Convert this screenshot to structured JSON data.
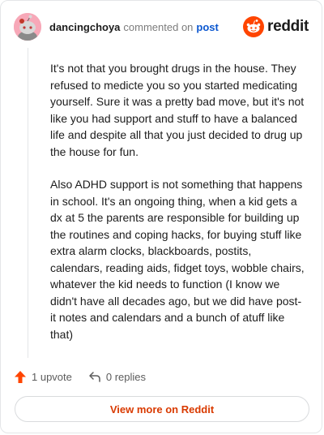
{
  "header": {
    "username": "dancingchoya",
    "action_text": "commented on",
    "post_link": "post",
    "logo_text": "reddit",
    "brand_color": "#ff4500"
  },
  "comment": {
    "paragraphs": [
      "It's not that you brought drugs in the house. They refused to medicte you so you started medicating yourself. Sure it was a pretty bad move, but it's not like you had support and stuff to have a balanced life and despite all that you just decided to drug up the house for fun.",
      "Also ADHD support is not something that happens in school. It's an ongoing thing, when a kid gets a dx at 5 the parents are responsible for building up the routines and coping hacks, for buying stuff like extra alarm clocks, blackboards, postits, calendars, reading aids, fidget toys, wobble chairs, whatever the kid needs to function (I know we didn't have all decades ago, but we did have post-it notes and calendars and a bunch of atuff like that)"
    ]
  },
  "actions": {
    "upvote_label": "1 upvote",
    "replies_label": "0 replies",
    "upvote_icon": "upvote-arrow-icon",
    "reply_icon": "reply-arrow-icon"
  },
  "footer": {
    "view_more_label": "View more on Reddit",
    "accent_color": "#d93a00"
  }
}
